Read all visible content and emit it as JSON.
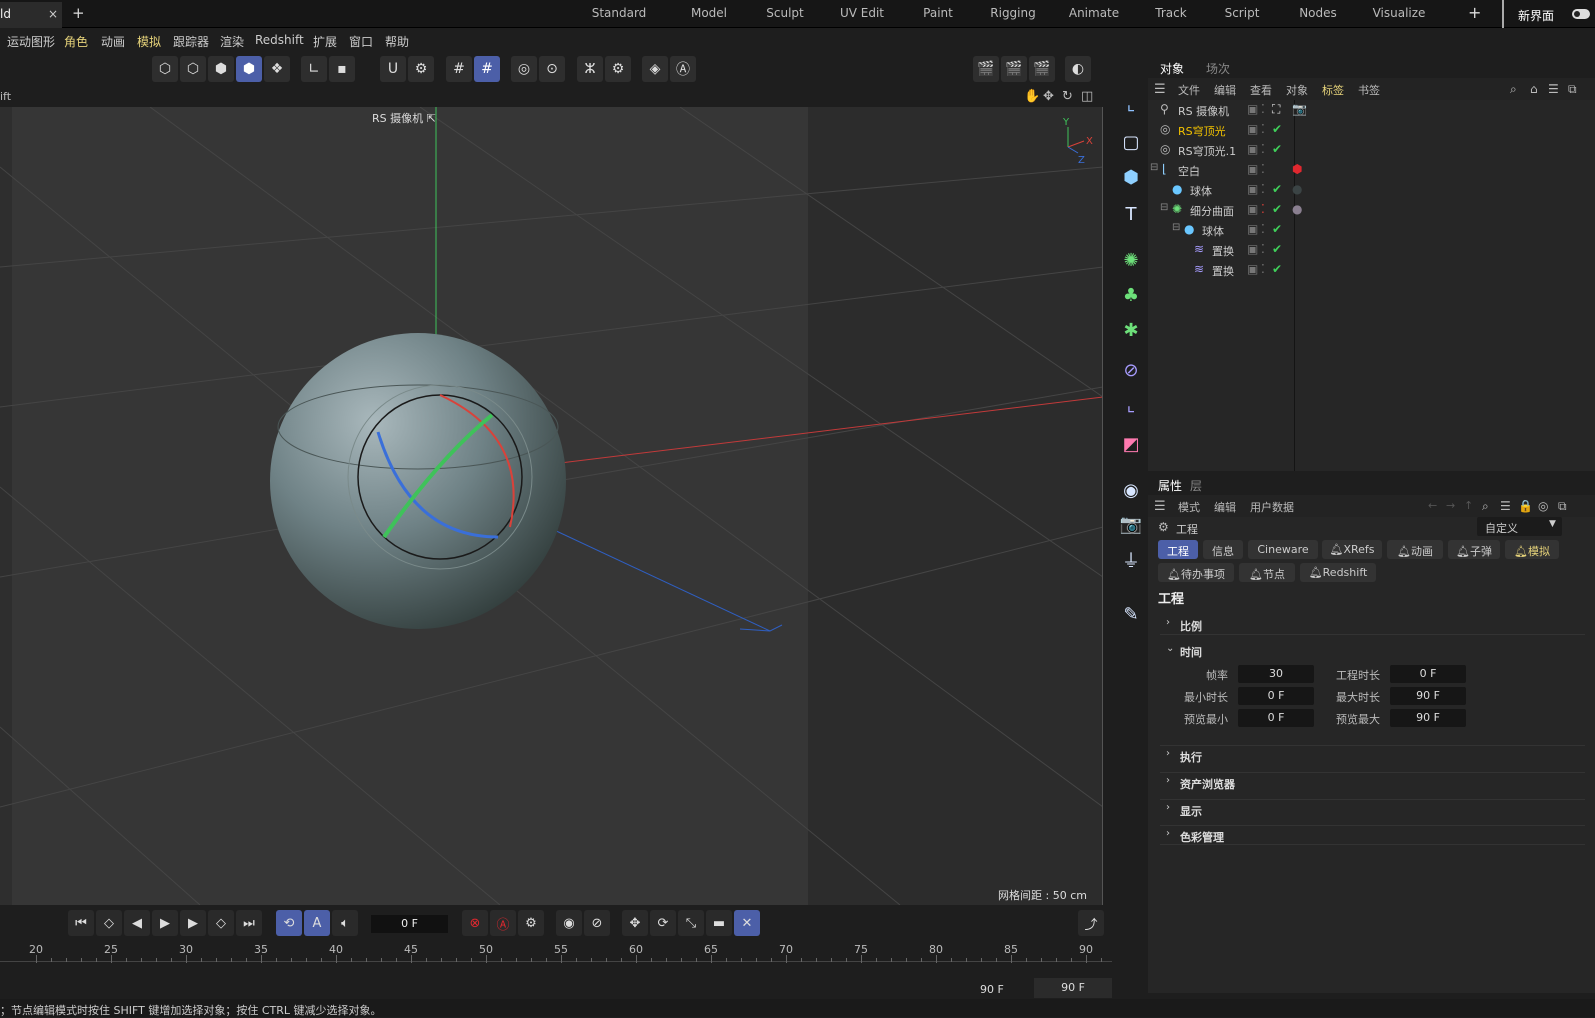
{
  "doc_tab": {
    "label": "ld",
    "close": "×",
    "new": "+"
  },
  "layouts": [
    "Standard",
    "Model",
    "Sculpt",
    "UV Edit",
    "Paint",
    "Rigging",
    "Animate",
    "Track",
    "Script",
    "Nodes",
    "Visualize"
  ],
  "layout_add": "+",
  "new_ui_label": "新界面",
  "menu": [
    "运动图形",
    "角色",
    "动画",
    "模拟",
    "跟踪器",
    "渲染",
    "Redshift",
    "扩展",
    "窗口",
    "帮助"
  ],
  "menu_highlight_color": "#e6d37a",
  "viewport": {
    "header_label": "ift",
    "camera_label": "RS 摄像机",
    "grid_label": "网格间距 : 50 cm",
    "axis_labels": {
      "y": "Y",
      "x": "X",
      "z": "Z"
    },
    "axis_colors": {
      "x": "#d9423a",
      "y": "#3fc25a",
      "z": "#3a6fd9"
    }
  },
  "object_panel": {
    "tabs": [
      "对象",
      "场次"
    ],
    "menu": [
      "文件",
      "编辑",
      "查看",
      "对象",
      "标签",
      "书签"
    ],
    "objects": [
      {
        "name": "RS 摄像机",
        "icon": "camera-icon",
        "color": "#cccccc"
      },
      {
        "name": "RS穹顶光",
        "icon": "dome-light-icon",
        "color": "#f2c200"
      },
      {
        "name": "RS穹顶光.1",
        "icon": "dome-light-icon",
        "color": "#cccccc"
      },
      {
        "name": "空白",
        "icon": "null-icon",
        "color": "#cccccc"
      },
      {
        "name": "球体",
        "icon": "sphere-icon",
        "color": "#cccccc"
      },
      {
        "name": "细分曲面",
        "icon": "subdivision-icon",
        "color": "#cccccc"
      },
      {
        "name": "球体",
        "icon": "sphere-icon",
        "color": "#cccccc"
      },
      {
        "name": "置换",
        "icon": "displacer-icon",
        "color": "#cccccc"
      },
      {
        "name": "置换",
        "icon": "displacer-icon",
        "color": "#cccccc"
      }
    ]
  },
  "attr_panel": {
    "tabs": [
      "属性",
      "层"
    ],
    "menu": [
      "模式",
      "编辑",
      "用户数据"
    ],
    "object_label": "工程",
    "preset": "自定义",
    "chips_row1": [
      "工程",
      "信息",
      "Cineware",
      "XRefs",
      "动画",
      "子弹",
      "模拟"
    ],
    "chips_row2": [
      "待办事项",
      "节点",
      "Redshift"
    ],
    "section_title": "工程",
    "sections": {
      "scale": "比例",
      "time": "时间",
      "execute": "执行",
      "asset_browser": "资产浏览器",
      "display": "显示",
      "color_mgmt": "色彩管理"
    },
    "time_fields": [
      {
        "label": "帧率",
        "value": "30"
      },
      {
        "label": "工程时长",
        "value": "0 F"
      },
      {
        "label": "最小时长",
        "value": "0 F"
      },
      {
        "label": "最大时长",
        "value": "90 F"
      },
      {
        "label": "预览最小",
        "value": "0 F"
      },
      {
        "label": "预览最大",
        "value": "90 F"
      }
    ]
  },
  "transport": {
    "current_frame": "0 F"
  },
  "timeline": {
    "ticks": [
      "20",
      "25",
      "30",
      "35",
      "40",
      "45",
      "50",
      "55",
      "60",
      "65",
      "70",
      "75",
      "80",
      "85",
      "90"
    ],
    "end_label": "90 F",
    "end_field": "90 F"
  },
  "status": "；节点编辑模式时按住 SHIFT 键增加选择对象；按住 CTRL 键减少选择对象。"
}
